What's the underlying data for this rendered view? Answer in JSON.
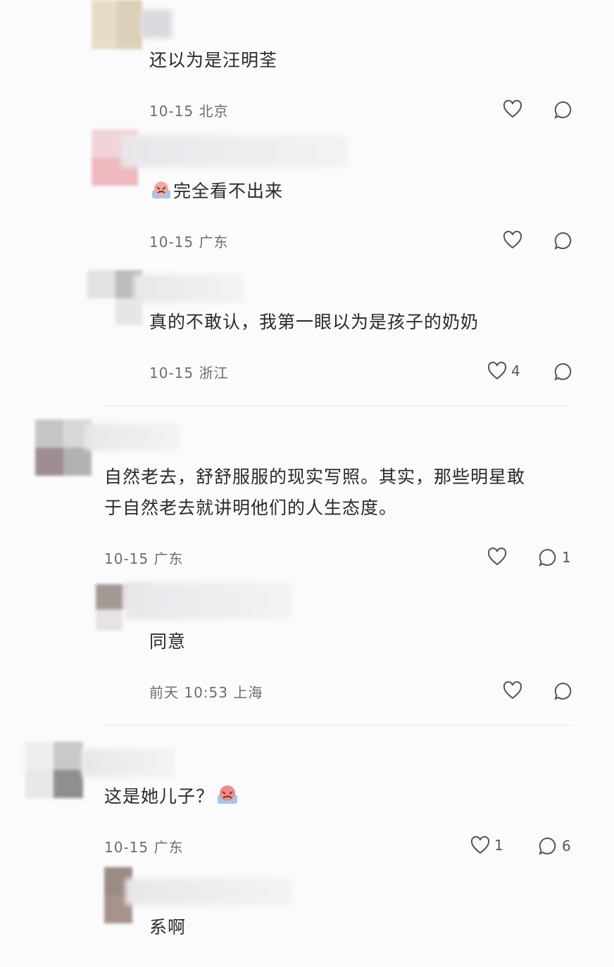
{
  "comments": [
    {
      "text": "还以为是汪明荃",
      "date": "10-15",
      "location": "北京",
      "likes": "",
      "replies": ""
    },
    {
      "text": "完全看不出来",
      "emoji": "crying-face-emoji",
      "date": "10-15",
      "location": "广东",
      "likes": "",
      "replies": ""
    },
    {
      "text": "真的不敢认，我第一眼以为是孩子的奶奶",
      "date": "10-15",
      "location": "浙江",
      "likes": "4",
      "replies": ""
    },
    {
      "text_line1": "自然老去，舒舒服服的现实写照。其实，那些明星敢",
      "text_line2": "于自然老去就讲明他们的人生态度。",
      "date": "10-15",
      "location": "广东",
      "likes": "",
      "replies": "1"
    },
    {
      "text": "同意",
      "date": "前天 10:53",
      "location": "上海",
      "likes": "",
      "replies": ""
    },
    {
      "text": "这是她儿子？",
      "emoji": "crying-face-emoji",
      "date": "10-15",
      "location": "广东",
      "likes": "1",
      "replies": "6"
    },
    {
      "text": "系啊"
    }
  ],
  "colors": {
    "background": "#fbfbfd",
    "text": "#2a2a2a",
    "meta": "#6d6d6d",
    "icon": "#555555",
    "divider": "#e6e6e8"
  },
  "icons": {
    "like": "heart-outline-icon",
    "reply": "speech-bubble-icon"
  }
}
